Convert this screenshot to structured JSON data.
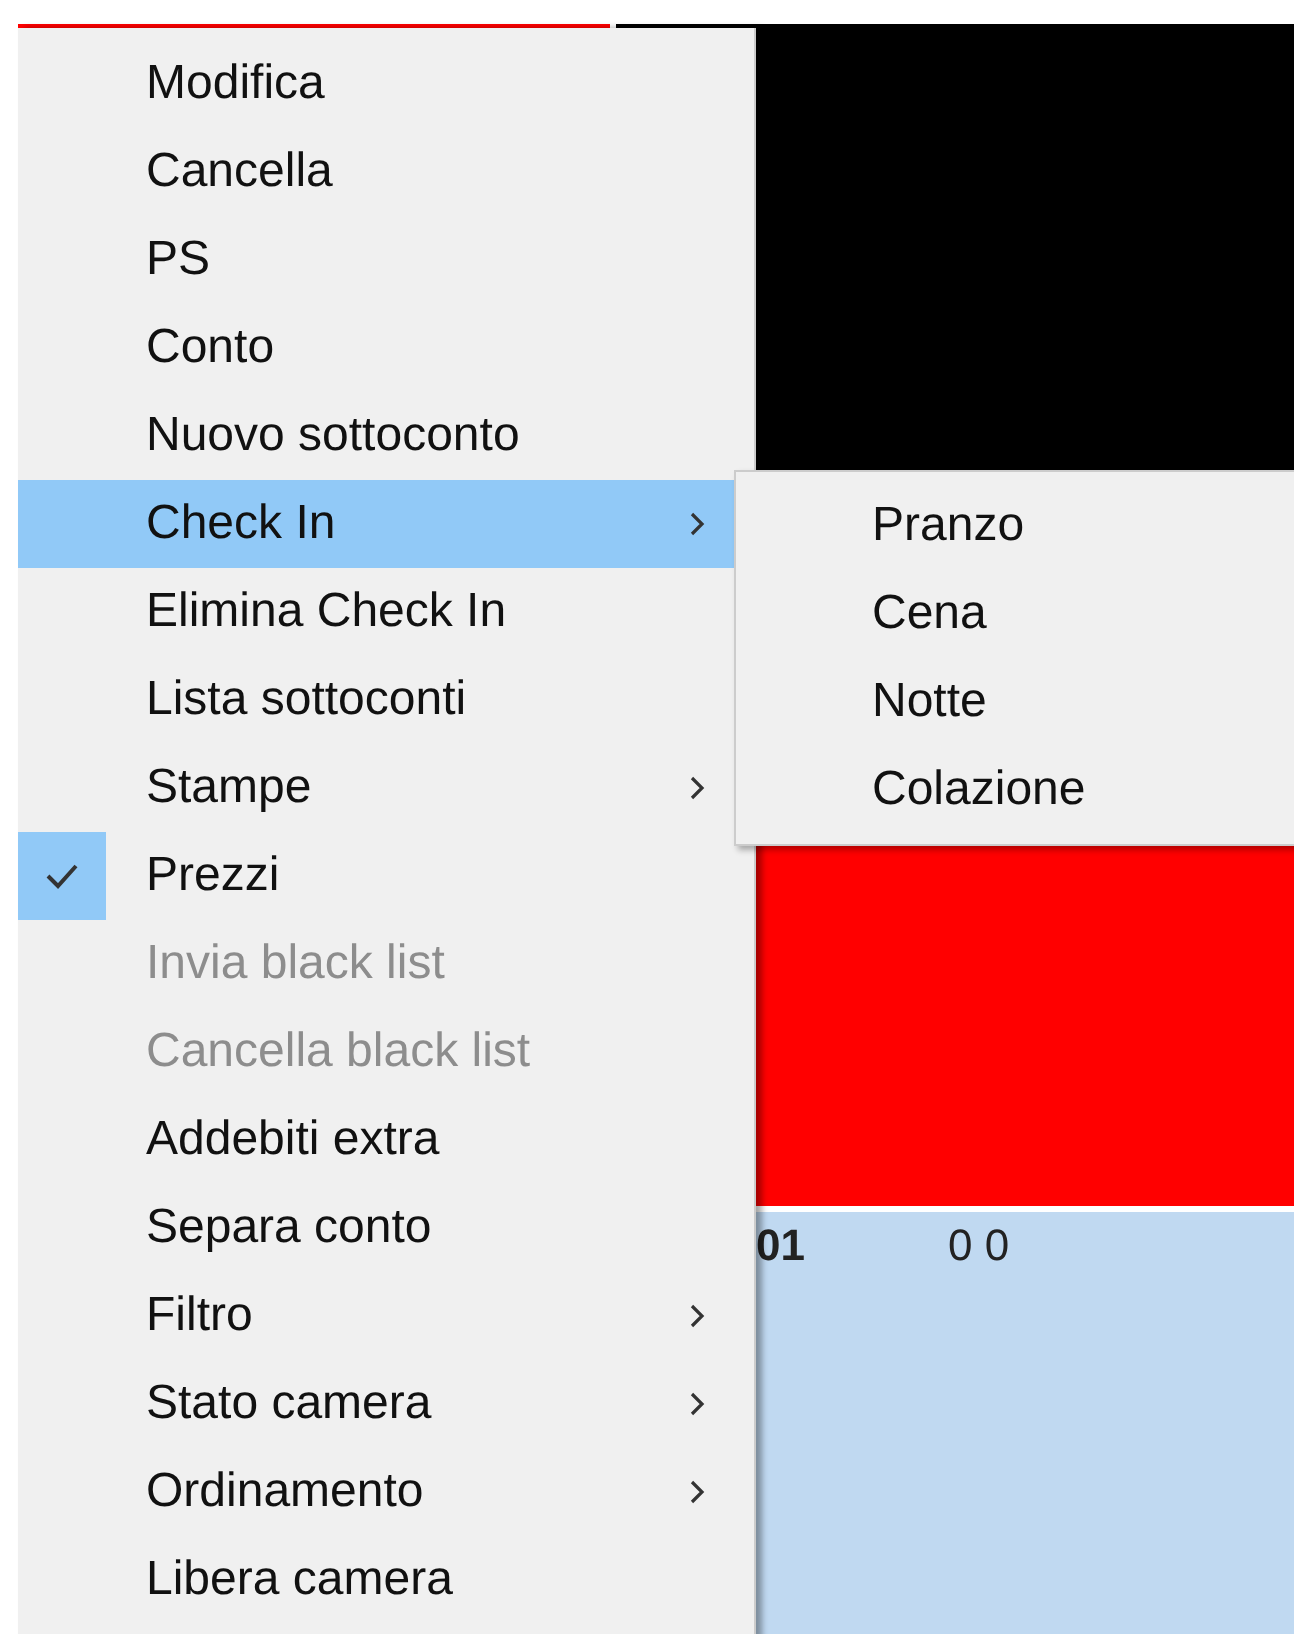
{
  "background": {
    "row_cells": [
      "01",
      "0 0"
    ]
  },
  "context_menu": {
    "items": [
      {
        "label": "Modifica",
        "selected": false,
        "checked": false,
        "disabled": false,
        "has_submenu": false
      },
      {
        "label": "Cancella",
        "selected": false,
        "checked": false,
        "disabled": false,
        "has_submenu": false
      },
      {
        "label": "PS",
        "selected": false,
        "checked": false,
        "disabled": false,
        "has_submenu": false
      },
      {
        "label": "Conto",
        "selected": false,
        "checked": false,
        "disabled": false,
        "has_submenu": false
      },
      {
        "label": "Nuovo sottoconto",
        "selected": false,
        "checked": false,
        "disabled": false,
        "has_submenu": false
      },
      {
        "label": "Check In",
        "selected": true,
        "checked": false,
        "disabled": false,
        "has_submenu": true
      },
      {
        "label": "Elimina Check In",
        "selected": false,
        "checked": false,
        "disabled": false,
        "has_submenu": false
      },
      {
        "label": "Lista sottoconti",
        "selected": false,
        "checked": false,
        "disabled": false,
        "has_submenu": false
      },
      {
        "label": "Stampe",
        "selected": false,
        "checked": false,
        "disabled": false,
        "has_submenu": true
      },
      {
        "label": "Prezzi",
        "selected": false,
        "checked": true,
        "disabled": false,
        "has_submenu": false
      },
      {
        "label": "Invia black list",
        "selected": false,
        "checked": false,
        "disabled": true,
        "has_submenu": false
      },
      {
        "label": "Cancella black list",
        "selected": false,
        "checked": false,
        "disabled": true,
        "has_submenu": false
      },
      {
        "label": "Addebiti extra",
        "selected": false,
        "checked": false,
        "disabled": false,
        "has_submenu": false
      },
      {
        "label": "Separa conto",
        "selected": false,
        "checked": false,
        "disabled": false,
        "has_submenu": false
      },
      {
        "label": "Filtro",
        "selected": false,
        "checked": false,
        "disabled": false,
        "has_submenu": true
      },
      {
        "label": "Stato camera",
        "selected": false,
        "checked": false,
        "disabled": false,
        "has_submenu": true
      },
      {
        "label": "Ordinamento",
        "selected": false,
        "checked": false,
        "disabled": false,
        "has_submenu": true
      },
      {
        "label": "Libera camera",
        "selected": false,
        "checked": false,
        "disabled": false,
        "has_submenu": false
      }
    ]
  },
  "submenu": {
    "items": [
      {
        "label": "Pranzo",
        "selected": false
      },
      {
        "label": "Cena",
        "selected": false
      },
      {
        "label": "Notte",
        "selected": false
      },
      {
        "label": "Colazione",
        "selected": false
      }
    ]
  }
}
